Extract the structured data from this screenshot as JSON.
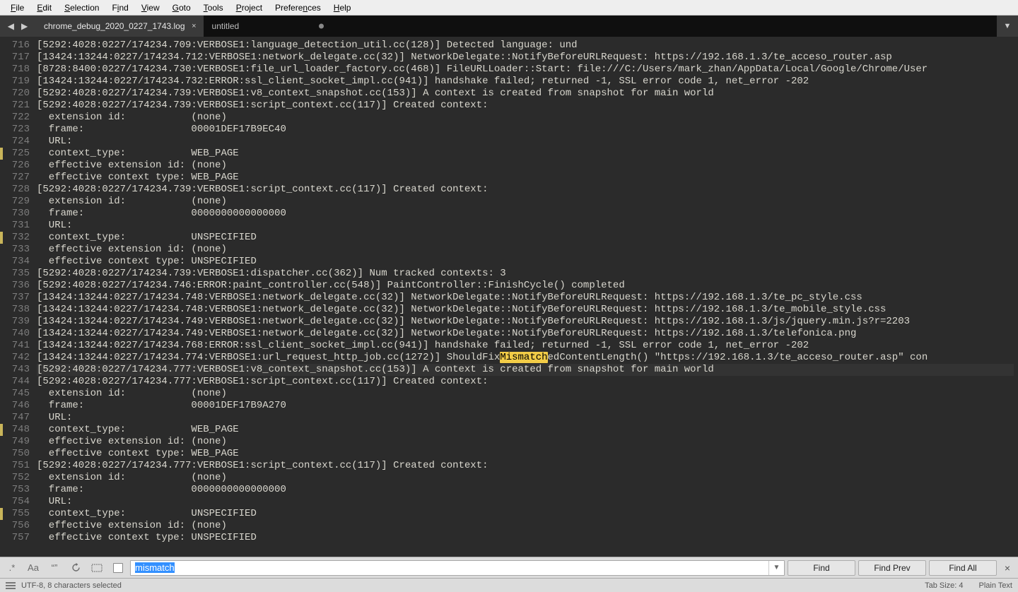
{
  "menu": [
    "File",
    "Edit",
    "Selection",
    "Find",
    "View",
    "Goto",
    "Tools",
    "Project",
    "Preferences",
    "Help"
  ],
  "tabs": {
    "nav_left": "◀",
    "nav_right": "▶",
    "items": [
      {
        "label": "chrome_debug_2020_0227_1743.log",
        "active": true,
        "dirty": false,
        "closable": true
      },
      {
        "label": "untitled",
        "active": false,
        "dirty": true,
        "closable": false
      }
    ],
    "expand": "▼"
  },
  "editor": {
    "first_line_no": 716,
    "marked_lines": [
      725,
      732,
      748,
      755
    ],
    "highlight_line_index": 27,
    "lines": [
      "[5292:4028:0227/174234.709:VERBOSE1:language_detection_util.cc(128)] Detected language: und",
      "[13424:13244:0227/174234.712:VERBOSE1:network_delegate.cc(32)] NetworkDelegate::NotifyBeforeURLRequest: https://192.168.1.3/te_acceso_router.asp",
      "[8728:8400:0227/174234.730:VERBOSE1:file_url_loader_factory.cc(468)] FileURLLoader::Start: file:///C:/Users/mark_zhan/AppData/Local/Google/Chrome/User",
      "[13424:13244:0227/174234.732:ERROR:ssl_client_socket_impl.cc(941)] handshake failed; returned -1, SSL error code 1, net_error -202",
      "[5292:4028:0227/174234.739:VERBOSE1:v8_context_snapshot.cc(153)] A context is created from snapshot for main world",
      "[5292:4028:0227/174234.739:VERBOSE1:script_context.cc(117)] Created context:",
      "  extension id:           (none)",
      "  frame:                  00001DEF17B9EC40",
      "  URL:                    ",
      "  context_type:           WEB_PAGE",
      "  effective extension id: (none)",
      "  effective context type: WEB_PAGE",
      "[5292:4028:0227/174234.739:VERBOSE1:script_context.cc(117)] Created context:",
      "  extension id:           (none)",
      "  frame:                  0000000000000000",
      "  URL:                    ",
      "  context_type:           UNSPECIFIED",
      "  effective extension id: (none)",
      "  effective context type: UNSPECIFIED",
      "[5292:4028:0227/174234.739:VERBOSE1:dispatcher.cc(362)] Num tracked contexts: 3",
      "[5292:4028:0227/174234.746:ERROR:paint_controller.cc(548)] PaintController::FinishCycle() completed",
      "[13424:13244:0227/174234.748:VERBOSE1:network_delegate.cc(32)] NetworkDelegate::NotifyBeforeURLRequest: https://192.168.1.3/te_pc_style.css",
      "[13424:13244:0227/174234.748:VERBOSE1:network_delegate.cc(32)] NetworkDelegate::NotifyBeforeURLRequest: https://192.168.1.3/te_mobile_style.css",
      "[13424:13244:0227/174234.749:VERBOSE1:network_delegate.cc(32)] NetworkDelegate::NotifyBeforeURLRequest: https://192.168.1.3/js/jquery.min.js?r=2203",
      "[13424:13244:0227/174234.749:VERBOSE1:network_delegate.cc(32)] NetworkDelegate::NotifyBeforeURLRequest: https://192.168.1.3/telefonica.png",
      "[13424:13244:0227/174234.768:ERROR:ssl_client_socket_impl.cc(941)] handshake failed; returned -1, SSL error code 1, net_error -202",
      "[13424:13244:0227/174234.774:VERBOSE1:url_request_http_job.cc(1272)] ShouldFix{{HL}}Mismatch{{/HL}}edContentLength() \"https://192.168.1.3/te_acceso_router.asp\" con",
      "[5292:4028:0227/174234.777:VERBOSE1:v8_context_snapshot.cc(153)] A context is created from snapshot for main world",
      "[5292:4028:0227/174234.777:VERBOSE1:script_context.cc(117)] Created context:",
      "  extension id:           (none)",
      "  frame:                  00001DEF17B9A270",
      "  URL:                    ",
      "  context_type:           WEB_PAGE",
      "  effective extension id: (none)",
      "  effective context type: WEB_PAGE",
      "[5292:4028:0227/174234.777:VERBOSE1:script_context.cc(117)] Created context:",
      "  extension id:           (none)",
      "  frame:                  0000000000000000",
      "  URL:                    ",
      "  context_type:           UNSPECIFIED",
      "  effective extension id: (none)",
      "  effective context type: UNSPECIFIED"
    ]
  },
  "find": {
    "options": {
      "regex": ".*",
      "case": "Aa",
      "whole_word": "“”",
      "wrap": "↻",
      "in_selection": "▭",
      "highlight": "☐"
    },
    "query": "mismatch",
    "buttons": {
      "find": "Find",
      "prev": "Find Prev",
      "all": "Find All"
    },
    "dropdown": "▼",
    "close": "×"
  },
  "status": {
    "encoding": "UTF-8, 8 characters selected",
    "tab_size": "Tab Size: 4",
    "syntax": "Plain Text"
  }
}
